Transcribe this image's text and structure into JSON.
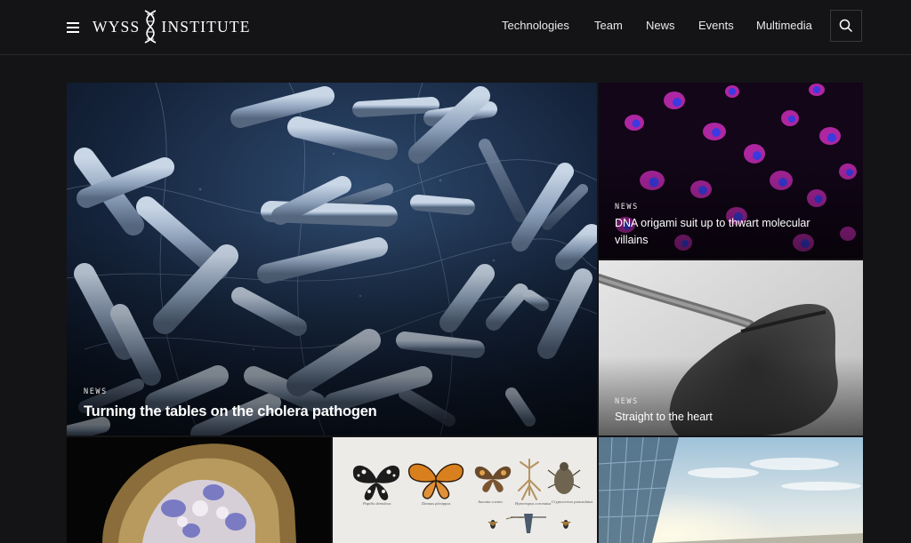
{
  "header": {
    "logo_left": "WYSS",
    "logo_right": "INSTITUTE",
    "nav": [
      "Technologies",
      "Team",
      "News",
      "Events",
      "Multimedia"
    ]
  },
  "features": {
    "main": {
      "category": "NEWS",
      "title": "Turning the tables on the cholera pathogen"
    },
    "top_right": {
      "category": "NEWS",
      "title": "DNA origami suit up to thwart molecular villains"
    },
    "middle_right": {
      "category": "NEWS",
      "title": "Straight to the heart"
    }
  },
  "specimens": {
    "labels": [
      "Papilio demoleus",
      "Danaus plexippus",
      "Junonia coenia",
      "Hymenopus coronatus",
      "Cryptocercus punctulatus"
    ]
  },
  "colors": {
    "background": "#141416",
    "header_border": "#2a2a2d"
  }
}
